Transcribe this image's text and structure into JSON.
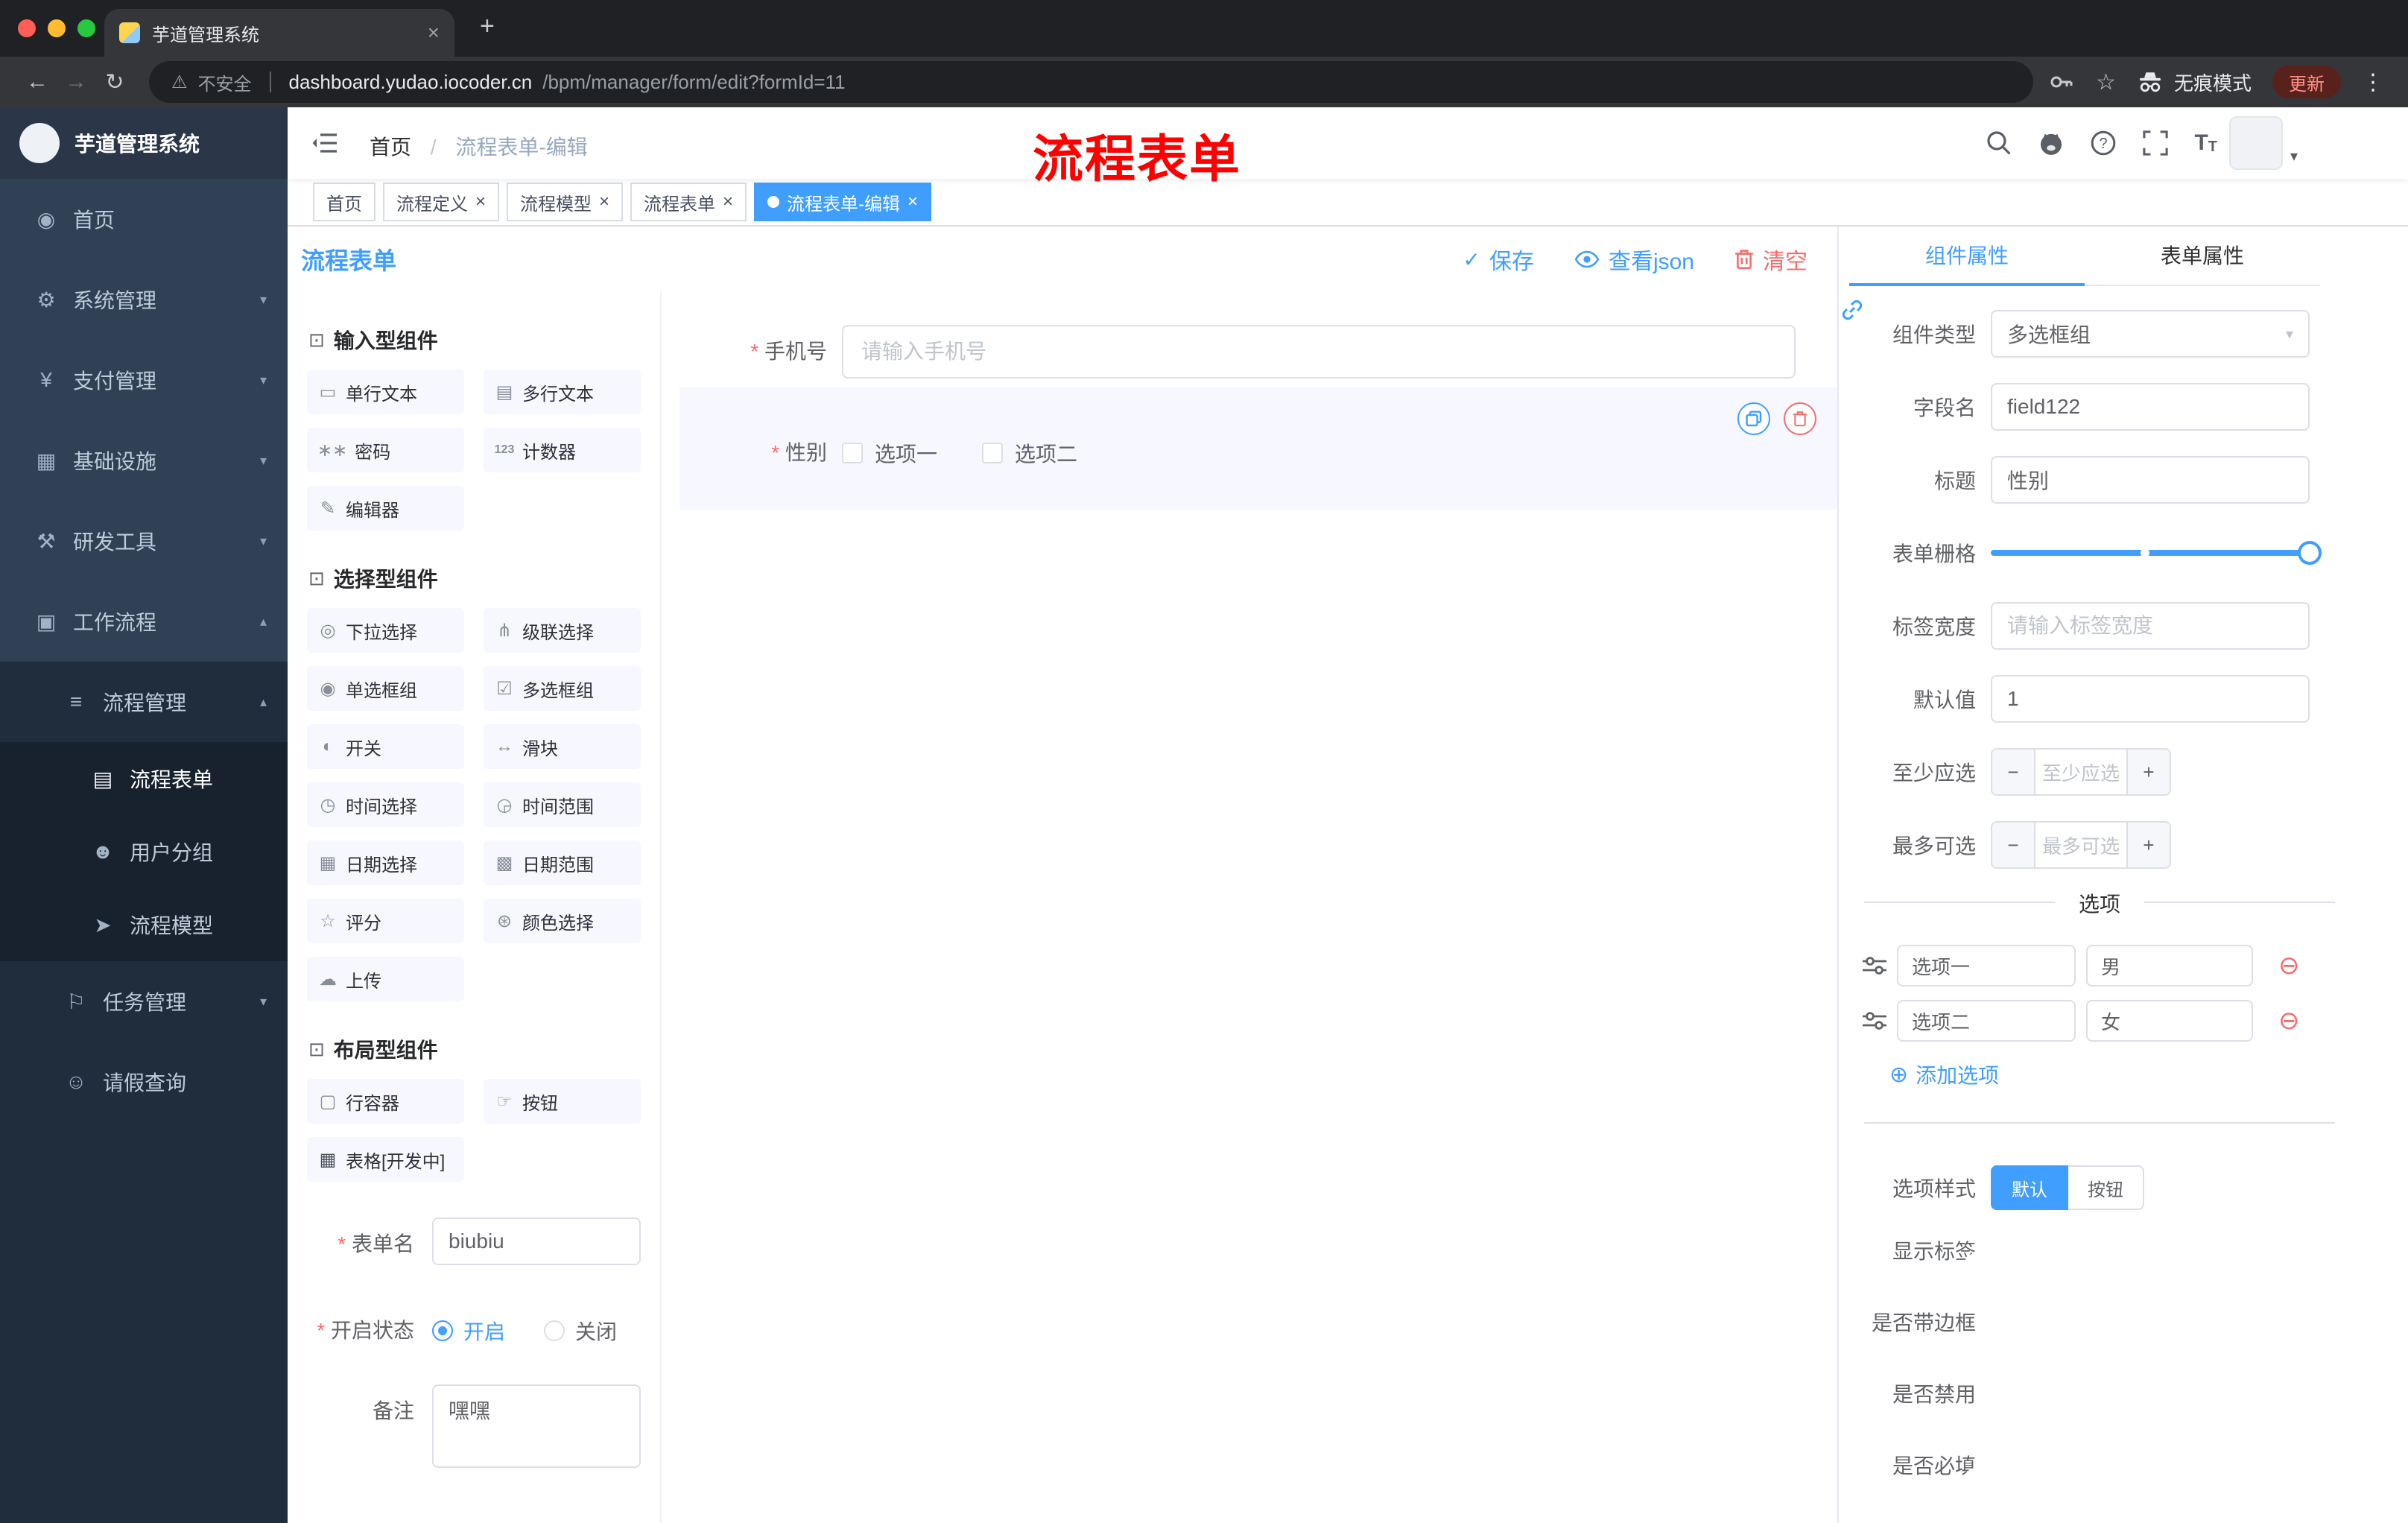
{
  "annotation": "流程表单",
  "ui": {
    "close": "×",
    "new_tab": "+",
    "back": "←",
    "forward": "→",
    "reload": "↻",
    "warning": "⚠",
    "star": "☆",
    "dots": "⋮",
    "chevron_down": "▾",
    "chevron_up": "▴",
    "check": "✓",
    "add_circle": "⊕",
    "remove_circle": "⊖",
    "caret_down": "▾",
    "minus": "−",
    "plus": "+",
    "select_arrow": "▾"
  },
  "browser": {
    "tab_title": "芋道管理系统",
    "security_label": "不安全",
    "url_host": "dashboard.yudao.iocoder.cn",
    "url_path": "/bpm/manager/form/edit?formId=11",
    "incognito_label": "无痕模式",
    "update_label": "更新"
  },
  "sidebar": {
    "logo_title": "芋道管理系统",
    "menu": [
      {
        "label": "首页",
        "glyph": "◉",
        "chevron": ""
      },
      {
        "label": "系统管理",
        "glyph": "⚙",
        "chevron": "▾"
      },
      {
        "label": "支付管理",
        "glyph": "¥",
        "chevron": "▾"
      },
      {
        "label": "基础设施",
        "glyph": "▦",
        "chevron": "▾"
      },
      {
        "label": "研发工具",
        "glyph": "⚒",
        "chevron": "▾"
      },
      {
        "label": "工作流程",
        "glyph": "▣",
        "chevron": "▴"
      },
      {
        "label": "流程管理",
        "glyph": "≡",
        "chevron": "▴"
      },
      {
        "label": "流程表单",
        "glyph": "▤",
        "chevron": ""
      },
      {
        "label": "用户分组",
        "glyph": "☻",
        "chevron": ""
      },
      {
        "label": "流程模型",
        "glyph": "➤",
        "chevron": ""
      },
      {
        "label": "任务管理",
        "glyph": "⚐",
        "chevron": "▾"
      },
      {
        "label": "请假查询",
        "glyph": "☺",
        "chevron": ""
      }
    ]
  },
  "navbar": {
    "breadcrumb": {
      "home": "首页",
      "separator": "/",
      "current": "流程表单-编辑"
    }
  },
  "tags": [
    {
      "label": "首页"
    },
    {
      "label": "流程定义"
    },
    {
      "label": "流程模型"
    },
    {
      "label": "流程表单"
    },
    {
      "label": "流程表单-编辑"
    }
  ],
  "designer": {
    "title": "流程表单",
    "actions": {
      "save": "保存",
      "view_json": "查看json",
      "clear": "清空"
    }
  },
  "palette": {
    "groups": [
      {
        "title": "输入型组件",
        "items": [
          {
            "label": "单行文本",
            "glyph": "▭"
          },
          {
            "label": "多行文本",
            "glyph": "▤"
          },
          {
            "label": "密码",
            "glyph": "∗∗"
          },
          {
            "label": "计数器",
            "glyph": "123"
          },
          {
            "label": "编辑器",
            "glyph": "✎"
          }
        ]
      },
      {
        "title": "选择型组件",
        "items": [
          {
            "label": "下拉选择",
            "glyph": "◎"
          },
          {
            "label": "级联选择",
            "glyph": "⋔"
          },
          {
            "label": "单选框组",
            "glyph": "◉"
          },
          {
            "label": "多选框组",
            "glyph": "☑"
          },
          {
            "label": "开关",
            "glyph": "◐"
          },
          {
            "label": "滑块",
            "glyph": "↔"
          },
          {
            "label": "时间选择",
            "glyph": "◷"
          },
          {
            "label": "时间范围",
            "glyph": "◶"
          },
          {
            "label": "日期选择",
            "glyph": "▦"
          },
          {
            "label": "日期范围",
            "glyph": "▩"
          },
          {
            "label": "评分",
            "glyph": "☆"
          },
          {
            "label": "颜色选择",
            "glyph": "⊛"
          },
          {
            "label": "上传",
            "glyph": "☁"
          }
        ]
      },
      {
        "title": "布局型组件",
        "items": [
          {
            "label": "行容器",
            "glyph": "▢"
          },
          {
            "label": "按钮",
            "glyph": "☞"
          },
          {
            "label": "表格[开发中]",
            "glyph": "▦"
          }
        ]
      }
    ],
    "form": {
      "name_label": "表单名",
      "name_value": "biubiu",
      "status_label": "开启状态",
      "status_on": "开启",
      "status_off": "关闭",
      "remark_label": "备注",
      "remark_value": "嘿嘿"
    }
  },
  "canvas": {
    "phone": {
      "label": "手机号",
      "placeholder": "请输入手机号"
    },
    "gender": {
      "label": "性别",
      "option1": "选项一",
      "option2": "选项二"
    }
  },
  "props": {
    "tab_component": "组件属性",
    "tab_form": "表单属性",
    "component_type_label": "组件类型",
    "component_type_value": "多选框组",
    "field_name_label": "字段名",
    "field_name_value": "field122",
    "title_label": "标题",
    "title_value": "性别",
    "grid_label": "表单栅格",
    "label_width_label": "标签宽度",
    "label_width_placeholder": "请输入标签宽度",
    "default_label": "默认值",
    "default_value": "1",
    "min_label": "至少应选",
    "min_placeholder": "至少应选",
    "max_label": "最多可选",
    "max_placeholder": "最多可选",
    "options_title": "选项",
    "options": [
      {
        "label": "选项一",
        "value": "男"
      },
      {
        "label": "选项二",
        "value": "女"
      }
    ],
    "add_option": "添加选项",
    "style_label": "选项样式",
    "style_default": "默认",
    "style_button": "按钮",
    "toggles": [
      {
        "label": "显示标签"
      },
      {
        "label": "是否带边框"
      },
      {
        "label": "是否禁用"
      },
      {
        "label": "是否必填"
      }
    ]
  },
  "colors": {
    "accent": "#409eff",
    "danger": "#f56c6c",
    "sidebar": "#304156",
    "sidebar_dark": "#1f2d3d"
  }
}
